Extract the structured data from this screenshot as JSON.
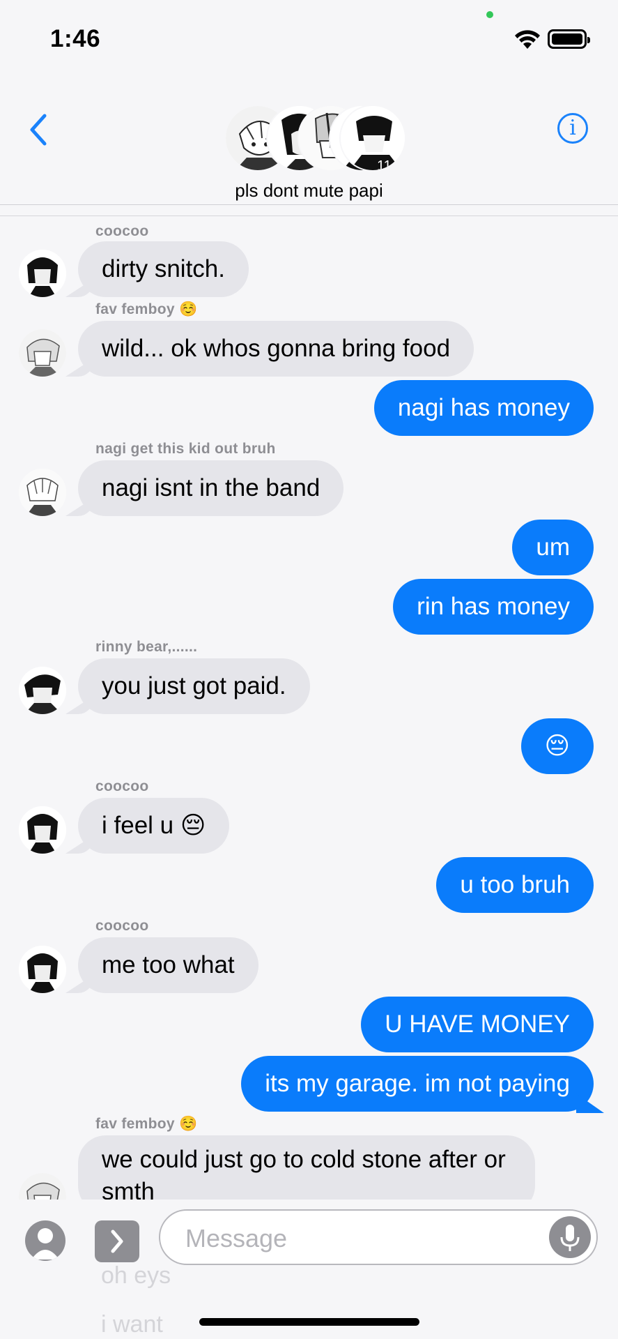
{
  "status": {
    "time": "1:46"
  },
  "header": {
    "title": "pls dont mute papi"
  },
  "messages": [
    {
      "sender": "coocoo",
      "text": "dirty snitch.",
      "dir": "in"
    },
    {
      "sender": "fav femboy ☺️",
      "text": "wild... ok whos gonna bring food",
      "dir": "in"
    },
    {
      "text": "nagi has money",
      "dir": "out"
    },
    {
      "sender": "nagi get this kid out bruh",
      "text": "nagi isnt in the band",
      "dir": "in"
    },
    {
      "text": "um",
      "dir": "out"
    },
    {
      "text": "rin has money",
      "dir": "out"
    },
    {
      "sender": "rinny bear,......",
      "text": "you just got paid.",
      "dir": "in"
    },
    {
      "text": "😔",
      "dir": "out"
    },
    {
      "sender": "coocoo",
      "text": "i feel u 😔",
      "dir": "in"
    },
    {
      "text": "u too bruh",
      "dir": "out"
    },
    {
      "sender": "coocoo",
      "text": "me too what",
      "dir": "in"
    },
    {
      "text": "U HAVE MONEY",
      "dir": "out"
    },
    {
      "text": "its my garage. im not paying",
      "dir": "out"
    },
    {
      "sender": "fav femboy ☺️",
      "text": "we could just go to cold stone after or smth",
      "dir": "in"
    }
  ],
  "composer": {
    "placeholder": "Message",
    "ghost_lines": [
      "oh eys",
      "i want"
    ]
  },
  "colors": {
    "accent": "#0a7cfb",
    "incoming": "#e5e5ea",
    "link": "#1a82fb"
  }
}
